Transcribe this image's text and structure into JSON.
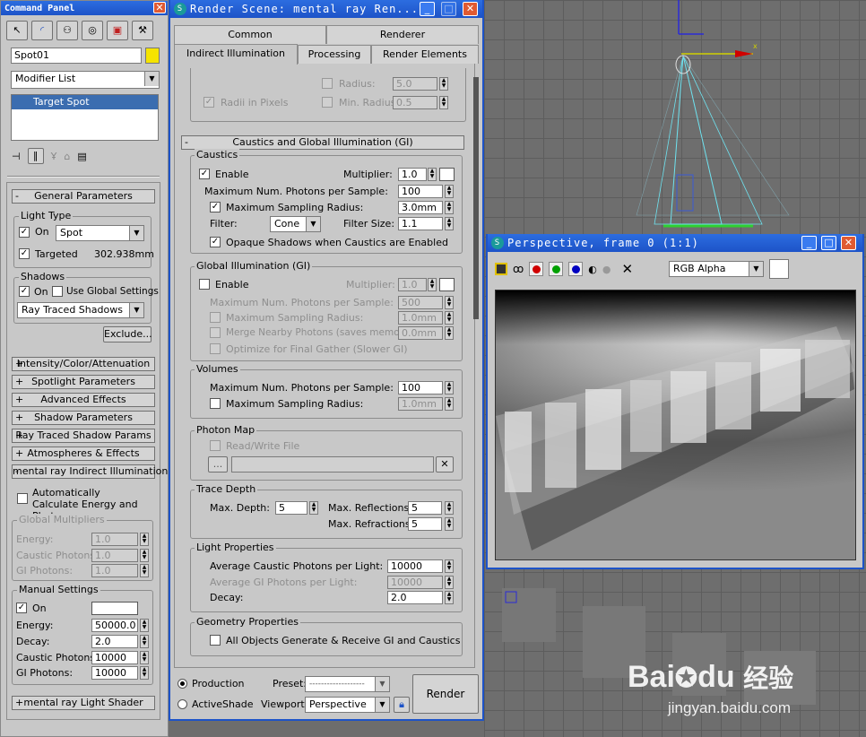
{
  "command_panel": {
    "title": "Command Panel",
    "object_name": "Spot01",
    "modifier_list": "Modifier List",
    "stack_item": "Target Spot",
    "general_rollout": "General Parameters",
    "light_type_group": "Light Type",
    "on_label": "On",
    "light_type_value": "Spot",
    "targeted_label": "Targeted",
    "targeted_distance": "302.938mm",
    "shadows_group": "Shadows",
    "shadows_on_label": "On",
    "use_global_label": "Use Global Settings",
    "shadow_type": "Ray Traced Shadows",
    "exclude_button": "Exclude...",
    "rollouts": [
      "Intensity/Color/Attenuation",
      "Spotlight Parameters",
      "Advanced Effects",
      "Shadow Parameters",
      "Ray Traced Shadow Params",
      "Atmospheres & Effects",
      "mental ray Indirect Illumination"
    ],
    "auto_calc_label": "Automatically Calculate Energy and Photons",
    "global_mult_group": "Global Multipliers",
    "global_mult": [
      {
        "label": "Energy:",
        "value": "1.0"
      },
      {
        "label": "Caustic Photons:",
        "value": "1.0"
      },
      {
        "label": "GI Photons:",
        "value": "1.0"
      }
    ],
    "manual_group": "Manual Settings",
    "manual_on_label": "On",
    "manual": [
      {
        "label": "Energy:",
        "value": "50000.0"
      },
      {
        "label": "Decay:",
        "value": "2.0"
      },
      {
        "label": "Caustic Photons:",
        "value": "10000"
      },
      {
        "label": "GI Photons:",
        "value": "10000"
      }
    ],
    "light_shader_rollout": "mental ray Light Shader"
  },
  "render_scene": {
    "title": "Render Scene: mental ray Ren...",
    "tabs_row1": [
      "Common",
      "Renderer"
    ],
    "tabs_row2": [
      "Indirect Illumination",
      "Processing",
      "Render Elements"
    ],
    "radius_label": "Radius:",
    "radius_value": "5.0",
    "radii_pixels_label": "Radii in Pixels",
    "min_radius_label": "Min. Radius:",
    "min_radius_value": "0.5",
    "cgi_rollout": "Caustics and Global Illumination (GI)",
    "caustics": {
      "group": "Caustics",
      "enable": "Enable",
      "multiplier_label": "Multiplier:",
      "multiplier": "1.0",
      "max_photons_label": "Maximum Num. Photons per Sample:",
      "max_photons": "100",
      "max_radius_label": "Maximum Sampling Radius:",
      "max_radius": "3.0mm",
      "filter_label": "Filter:",
      "filter": "Cone",
      "filter_size_label": "Filter Size:",
      "filter_size": "1.1",
      "opaque_label": "Opaque Shadows when Caustics are Enabled"
    },
    "gi": {
      "group": "Global Illumination (GI)",
      "enable": "Enable",
      "multiplier_label": "Multiplier:",
      "multiplier": "1.0",
      "max_photons_label": "Maximum Num. Photons per Sample:",
      "max_photons": "500",
      "max_radius_label": "Maximum Sampling Radius:",
      "max_radius": "1.0mm",
      "merge_label": "Merge Nearby Photons (saves memory):",
      "merge": "0.0mm",
      "optimize_label": "Optimize for Final Gather (Slower GI)"
    },
    "volumes": {
      "group": "Volumes",
      "max_photons_label": "Maximum Num. Photons per Sample:",
      "max_photons": "100",
      "max_radius_label": "Maximum Sampling Radius:",
      "max_radius": "1.0mm"
    },
    "photon_map": {
      "group": "Photon Map",
      "readwrite": "Read/Write File",
      "browse": "..."
    },
    "trace_depth": {
      "group": "Trace Depth",
      "max_depth_label": "Max. Depth:",
      "max_depth": "5",
      "max_refl_label": "Max. Reflections:",
      "max_refl": "5",
      "max_refr_label": "Max. Refractions:",
      "max_refr": "5"
    },
    "light_props": {
      "group": "Light Properties",
      "avg_caustic_label": "Average Caustic Photons per Light:",
      "avg_caustic": "10000",
      "avg_gi_label": "Average GI Photons per Light:",
      "avg_gi": "10000",
      "decay_label": "Decay:",
      "decay": "2.0"
    },
    "geometry": {
      "group": "Geometry Properties",
      "all_objects": "All Objects Generate & Receive GI and Caustics"
    },
    "production": "Production",
    "activeshade": "ActiveShade",
    "preset_label": "Preset:",
    "preset": "-------------------",
    "viewport_label": "Viewport:",
    "viewport": "Perspective",
    "render_button": "Render"
  },
  "frame_window": {
    "title": "Perspective, frame 0 (1:1)",
    "channel": "RGB Alpha"
  },
  "watermark": {
    "brand": "Bai",
    "brand2": "du",
    "cn": "经验",
    "url": "jingyan.baidu.com"
  }
}
